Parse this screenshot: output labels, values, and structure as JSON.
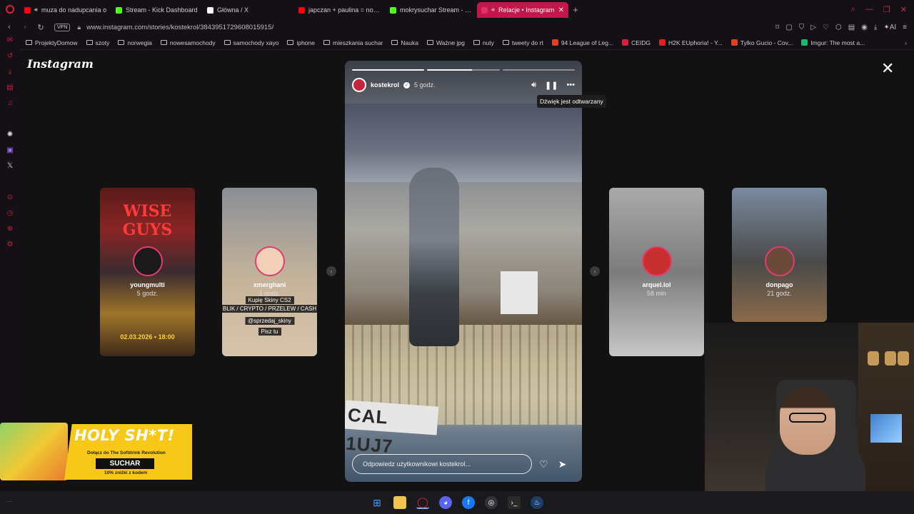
{
  "browser": {
    "tabs": [
      {
        "label": "muza do nadupcania o",
        "favicon_color": "#ff0000",
        "audio": true,
        "active": false
      },
      {
        "label": "Stream - Kick Dashboard",
        "favicon_color": "#53fc18",
        "audio": false,
        "active": false
      },
      {
        "label": "Główna / X",
        "favicon_color": "#ffffff",
        "audio": false,
        "active": false
      },
      {
        "label": "japczan + paulina = norma",
        "favicon_color": "#ff0000",
        "audio": false,
        "active": false
      },
      {
        "label": "mokrysuchar Stream - We",
        "favicon_color": "#53fc18",
        "audio": false,
        "active": false
      },
      {
        "label": "Relacje • Instagram",
        "favicon_color": "#e1306c",
        "audio": true,
        "active": true
      }
    ],
    "new_tab_icon": "plus-icon",
    "address": {
      "vpn_label": "VPN",
      "url": "www.instagram.com/stories/kostekrol/3843951729608015915/"
    },
    "bookmarks": [
      {
        "label": "ProjektyDomow",
        "type": "folder"
      },
      {
        "label": "szoty",
        "type": "folder"
      },
      {
        "label": "norwegia",
        "type": "folder"
      },
      {
        "label": "nowesamochody",
        "type": "folder"
      },
      {
        "label": "samochody xayo",
        "type": "folder"
      },
      {
        "label": "iphone",
        "type": "folder"
      },
      {
        "label": "mieszkania suchar",
        "type": "folder"
      },
      {
        "label": "Nauka",
        "type": "folder"
      },
      {
        "label": "Ważne jpg",
        "type": "folder"
      },
      {
        "label": "nuty",
        "type": "folder"
      },
      {
        "label": "tweety do rt",
        "type": "folder"
      },
      {
        "label": "94 League of Leg...",
        "type": "site",
        "color": "#e04020"
      },
      {
        "label": "CEIDG",
        "type": "site",
        "color": "#d8203a"
      },
      {
        "label": "H2K EUphoria! - Y...",
        "type": "site",
        "color": "#e02020"
      },
      {
        "label": "Tylko Gucio - Cov...",
        "type": "site",
        "color": "#e04020"
      },
      {
        "label": "Imgur: The most a...",
        "type": "site",
        "color": "#1bb76e"
      }
    ]
  },
  "instagram": {
    "logo_text": "Instagram",
    "close_icon": "close-icon",
    "previews_left": [
      {
        "username": "youngmulti",
        "time": "5 godz.",
        "poster_title": "WISE GUYS",
        "poster_date": "02.03.2026 • 18:00"
      },
      {
        "username": "xmerghani",
        "time": "1 godz.",
        "captions": [
          "Kupię Skiny CS2",
          "BLIK / CRYPTO / PRZELEW / CASH",
          "@sprzedaj_skiny",
          "Pisz tu"
        ]
      }
    ],
    "previews_right": [
      {
        "username": "arquel.lol",
        "time": "58 min"
      },
      {
        "username": "donpago",
        "time": "21 godz."
      }
    ],
    "story": {
      "username": "kostekrol",
      "verified_icon": "verified-badge-icon",
      "time": "5 godz.",
      "progress_segments": 3,
      "progress_current_index": 1,
      "progress_current_fraction": 0.62,
      "tooltip": "Dźwięk jest odtwarzany",
      "plate_text": "CAL 1UJ7",
      "reply_placeholder": "Odpowiedz użytkownikowi kostekrol...",
      "icons": [
        "speaker-icon",
        "pause-icon",
        "more-icon",
        "heart-icon",
        "send-icon"
      ]
    }
  },
  "sponsor": {
    "headline": "HOLY SH*T!",
    "subline": "Dołącz do The Softdrink Revolution",
    "code": "SUCHAR",
    "discount": "10% zniżki z kodem"
  },
  "taskbar": {
    "apps": [
      "windows-start-icon",
      "file-explorer-icon",
      "opera-gx-icon",
      "discord-icon",
      "facebook-icon",
      "obs-icon",
      "terminal-icon",
      "steam-icon"
    ]
  }
}
